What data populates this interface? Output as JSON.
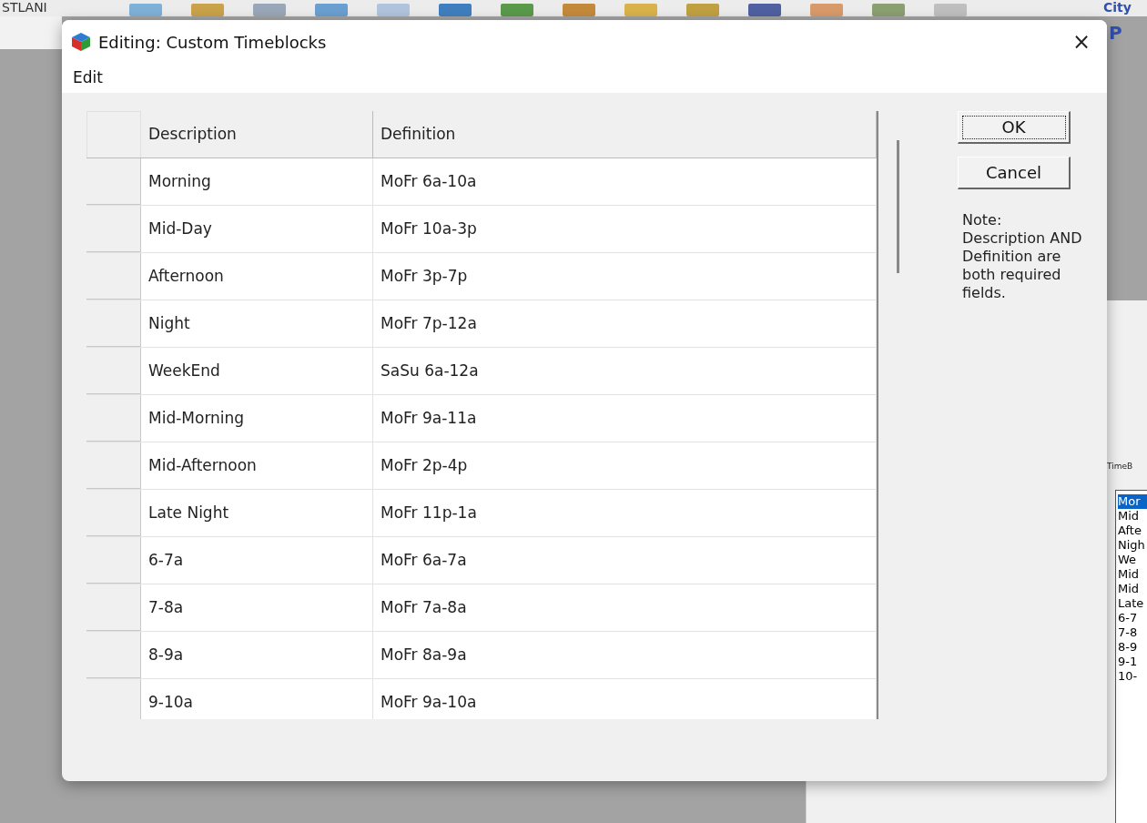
{
  "background_app": {
    "logo_text": "STLANI",
    "corner_text": "City",
    "corner_letter": "P",
    "panel_label": "TimeB",
    "list_items": [
      {
        "label": "Mor",
        "selected": true
      },
      {
        "label": "Mid",
        "selected": false
      },
      {
        "label": "Afte",
        "selected": false
      },
      {
        "label": "Nigh",
        "selected": false
      },
      {
        "label": "We",
        "selected": false
      },
      {
        "label": "Mid",
        "selected": false
      },
      {
        "label": "Mid",
        "selected": false
      },
      {
        "label": "Late",
        "selected": false
      },
      {
        "label": "6-7",
        "selected": false
      },
      {
        "label": "7-8",
        "selected": false
      },
      {
        "label": "8-9",
        "selected": false
      },
      {
        "label": "9-1",
        "selected": false
      },
      {
        "label": "10-",
        "selected": false
      }
    ]
  },
  "dialog": {
    "title": "Editing: Custom Timeblocks",
    "close": "×",
    "menu": [
      "Edit"
    ],
    "table": {
      "columns": [
        "Description",
        "Definition"
      ],
      "rows": [
        [
          "Morning",
          "MoFr 6a-10a"
        ],
        [
          "Mid-Day",
          "MoFr 10a-3p"
        ],
        [
          "Afternoon",
          "MoFr 3p-7p"
        ],
        [
          "Night",
          "MoFr 7p-12a"
        ],
        [
          "WeekEnd",
          "SaSu 6a-12a"
        ],
        [
          "Mid-Morning",
          "MoFr 9a-11a"
        ],
        [
          "Mid-Afternoon",
          "MoFr 2p-4p"
        ],
        [
          "Late Night",
          "MoFr 11p-1a"
        ],
        [
          "6-7a",
          "MoFr 6a-7a"
        ],
        [
          "7-8a",
          "MoFr 7a-8a"
        ],
        [
          "8-9a",
          "MoFr 8a-9a"
        ],
        [
          "9-10a",
          "MoFr 9a-10a"
        ]
      ]
    },
    "buttons": [
      {
        "label": "OK",
        "default": true
      },
      {
        "label": "Cancel",
        "default": false
      }
    ],
    "note": "Note: Description AND Definition are both required fields."
  }
}
